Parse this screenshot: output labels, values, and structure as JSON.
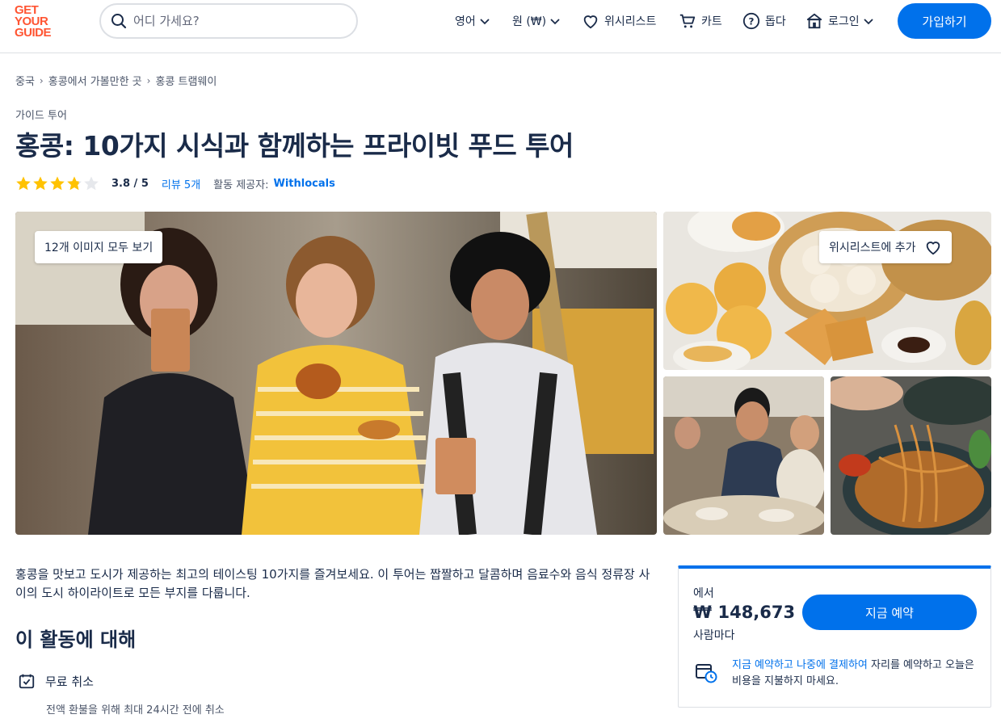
{
  "header": {
    "logo": [
      "GET",
      "YOUR",
      "GUIDE"
    ],
    "search_placeholder": "어디 가세요?",
    "language": "영어",
    "currency": "원 (₩)",
    "wishlist": "위시리스트",
    "cart": "카트",
    "help": "돕다",
    "login": "로그인",
    "signup": "가입하기"
  },
  "breadcrumb": [
    "중국",
    "홍콩에서 가볼만한 곳",
    "홍콩 트램웨이"
  ],
  "activity": {
    "category": "가이드 투어",
    "title": "홍콩: 10가지 시식과 함께하는 프라이빗 푸드 투어",
    "rating": "3.8 / 5",
    "rating_value": 3.8,
    "reviews": "리뷰 5개",
    "provider_label": "활동 제공자:",
    "provider": "Withlocals"
  },
  "gallery": {
    "view_all": "12개 이미지 모두 보기",
    "add_wishlist": "위시리스트에 추가"
  },
  "description": "홍콩을 맛보고 도시가 제공하는 최고의 테이스팅 10가지를 즐겨보세요. 이 투어는 짭짤하고 달콤하며 음료수와 음식 정류장 사이의 도시 하이라이트로 모든 부지를 다룹니다.",
  "about": {
    "title": "이 활동에 대해",
    "features": [
      {
        "title": "무료 취소",
        "subtitle": "전액 환불을 위해 최대 24시간 전에 취소"
      }
    ]
  },
  "booking": {
    "from": "에서",
    "price": "₩ 148,673",
    "per": "사람마다",
    "book_button": "지금 예약",
    "note_link": "지금 예약하고 나중에 결제하여",
    "note_text": " 자리를 예약하고 오늘은 비용을 지불하지 마세요."
  },
  "colors": {
    "primary": "#0071eb",
    "brand": "#ff5533",
    "text": "#1a2b49",
    "star": "#ffc200"
  }
}
